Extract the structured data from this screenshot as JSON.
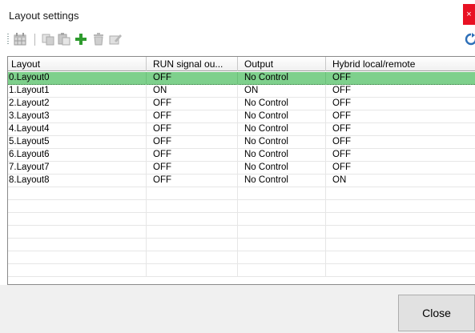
{
  "window": {
    "title": "Layout settings",
    "close_glyph": "×"
  },
  "toolbar": {
    "icons": [
      "layout-grid-icon",
      "copy-icon",
      "paste-icon",
      "add-icon",
      "delete-icon",
      "edit-icon",
      "refresh-icon"
    ],
    "colors": {
      "add": "#2e9b2e",
      "refresh": "#2d6fb8",
      "disabled": "#b0b0b0"
    }
  },
  "table": {
    "columns": [
      "Layout",
      "RUN signal ou...",
      "Output",
      "Hybrid local/remote"
    ],
    "rows": [
      [
        "0.Layout0",
        "OFF",
        "No Control",
        "OFF"
      ],
      [
        "1.Layout1",
        "ON",
        "ON",
        "OFF"
      ],
      [
        "2.Layout2",
        "OFF",
        "No Control",
        "OFF"
      ],
      [
        "3.Layout3",
        "OFF",
        "No Control",
        "OFF"
      ],
      [
        "4.Layout4",
        "OFF",
        "No Control",
        "OFF"
      ],
      [
        "5.Layout5",
        "OFF",
        "No Control",
        "OFF"
      ],
      [
        "6.Layout6",
        "OFF",
        "No Control",
        "OFF"
      ],
      [
        "7.Layout7",
        "OFF",
        "No Control",
        "OFF"
      ],
      [
        "8.Layout8",
        "OFF",
        "No Control",
        "ON"
      ]
    ],
    "selected_row": 0,
    "selected_color": "#7ed08c"
  },
  "footer": {
    "close_label": "Close"
  }
}
